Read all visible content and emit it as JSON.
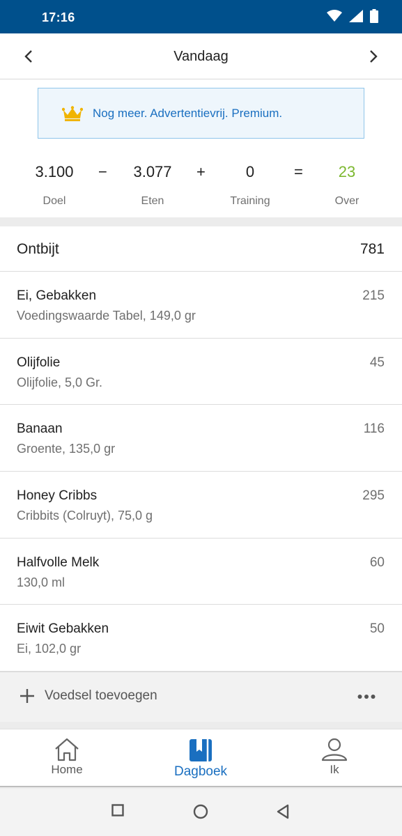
{
  "status_bar": {
    "time": "17:16"
  },
  "header": {
    "title": "Vandaag"
  },
  "promo": {
    "text": "Nog meer. Advertentievrij. Premium."
  },
  "equation": {
    "goal": {
      "value": "3.100",
      "label": "Doel"
    },
    "op_minus": "−",
    "food": {
      "value": "3.077",
      "label": "Eten"
    },
    "op_plus": "+",
    "exercise": {
      "value": "0",
      "label": "Training"
    },
    "op_equals": "=",
    "remaining": {
      "value": "23",
      "label": "Over"
    },
    "remaining_color": "#7cb82f"
  },
  "meal": {
    "name": "Ontbijt",
    "calories": "781",
    "items": [
      {
        "name": "Ei, Gebakken",
        "desc": "Voedingswaarde Tabel, 149,0 gr",
        "cal": "215"
      },
      {
        "name": "Olijfolie",
        "desc": "Olijfolie, 5,0 Gr.",
        "cal": "45"
      },
      {
        "name": "Banaan",
        "desc": "Groente, 135,0 gr",
        "cal": "116"
      },
      {
        "name": "Honey Cribbs",
        "desc": "Cribbits (Colruyt), 75,0 g",
        "cal": "295"
      },
      {
        "name": "Halfvolle Melk",
        "desc": "130,0 ml",
        "cal": "60"
      },
      {
        "name": "Eiwit Gebakken",
        "desc": "Ei, 102,0 gr",
        "cal": "50"
      }
    ],
    "add_label": "Voedsel toevoegen"
  },
  "bottom_nav": {
    "tabs": [
      {
        "label": "Home",
        "icon": "home-icon"
      },
      {
        "label": "Dagboek",
        "icon": "diary-icon",
        "active": true
      },
      {
        "label": "Ik",
        "icon": "person-icon"
      }
    ]
  },
  "colors": {
    "brand": "#00508c",
    "accent": "#1a6fc0",
    "positive": "#7cb82f"
  }
}
